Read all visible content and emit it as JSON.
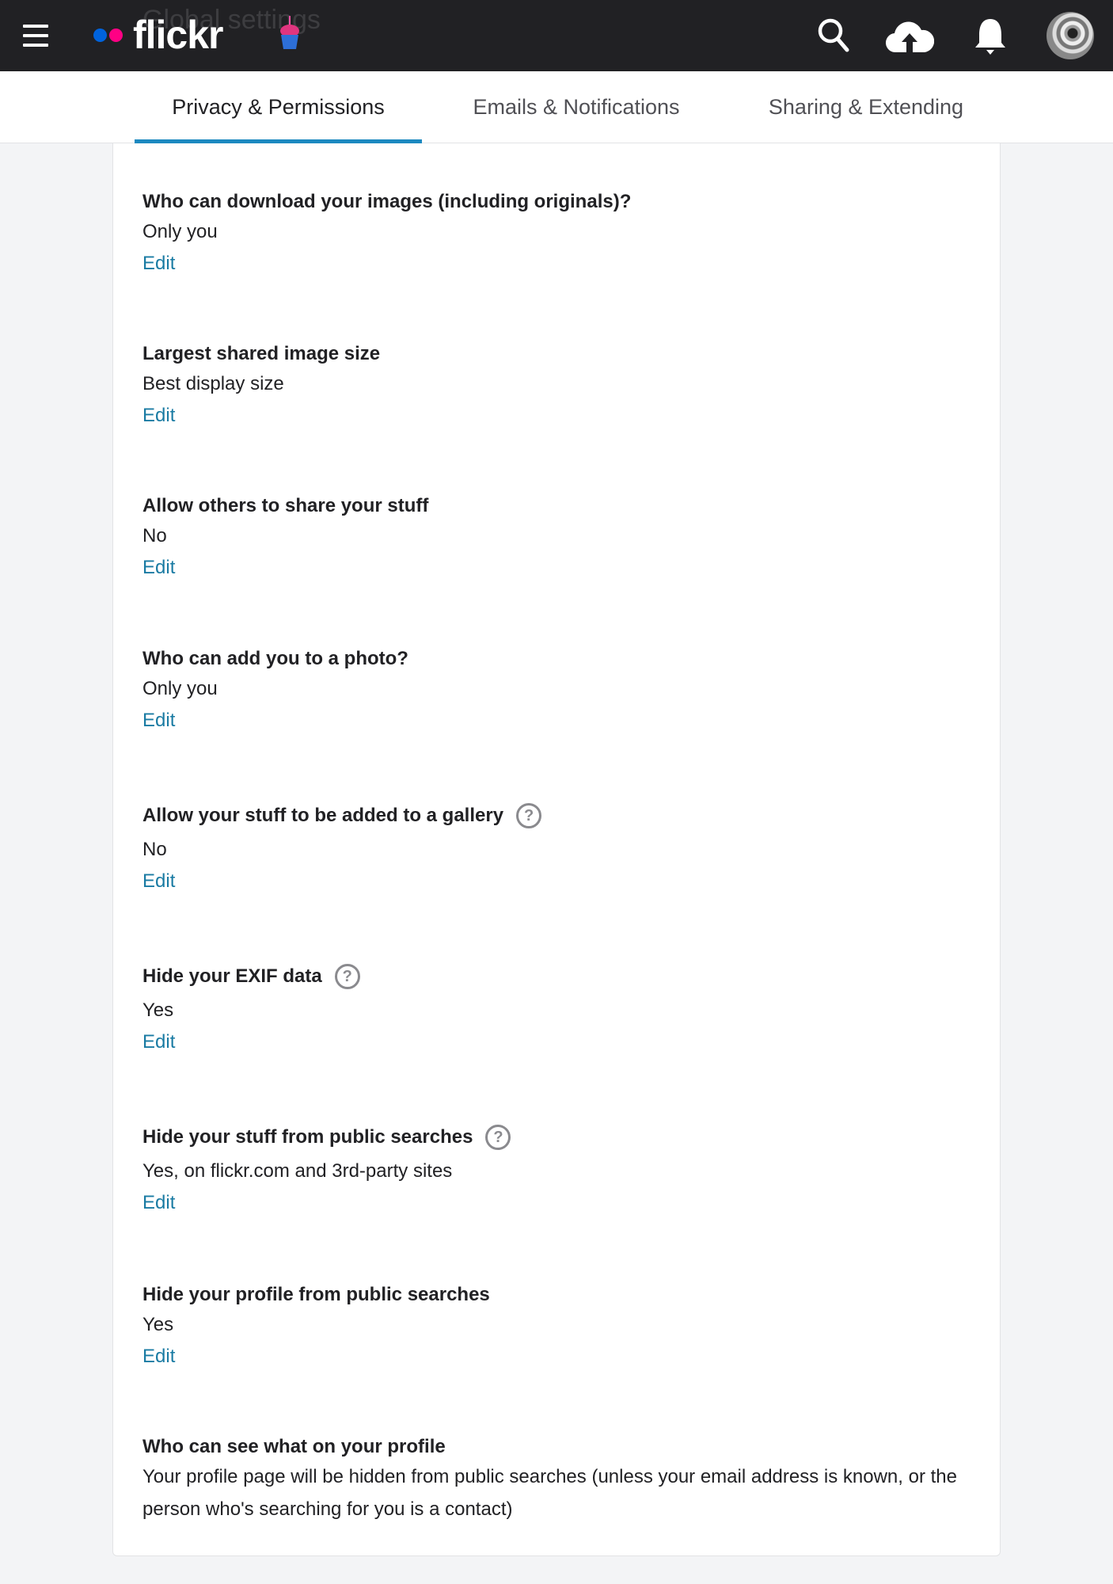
{
  "header": {
    "background_title": "Global settings",
    "logo_text": "flickr",
    "logo_dot_colors": [
      "#0063dc",
      "#ff0084"
    ],
    "icons": [
      "menu-icon",
      "cupcake-icon",
      "search-icon",
      "upload-cloud-icon",
      "bell-icon",
      "avatar"
    ]
  },
  "tabs": [
    {
      "label": "Privacy & Permissions",
      "active": true
    },
    {
      "label": "Emails & Notifications",
      "active": false
    },
    {
      "label": "Sharing & Extending",
      "active": false
    }
  ],
  "accent_color": "#1c89c0",
  "link_color": "#1a7ba3",
  "settings": [
    {
      "title": "Who can download your images (including originals)?",
      "value": "Only you",
      "edit": "Edit",
      "help": false
    },
    {
      "title": "Largest shared image size",
      "value": "Best display size",
      "edit": "Edit",
      "help": false
    },
    {
      "title": "Allow others to share your stuff",
      "value": "No",
      "edit": "Edit",
      "help": false
    },
    {
      "title": "Who can add you to a photo?",
      "value": "Only you",
      "edit": "Edit",
      "help": false
    },
    {
      "title": "Allow your stuff to be added to a gallery",
      "value": "No",
      "edit": "Edit",
      "help": true
    },
    {
      "title": "Hide your EXIF data",
      "value": "Yes",
      "edit": "Edit",
      "help": true
    },
    {
      "title": "Hide your stuff from public searches",
      "value": "Yes, on flickr.com and 3rd-party sites",
      "edit": "Edit",
      "help": true
    },
    {
      "title": "Hide your profile from public searches",
      "value": "Yes",
      "edit": "Edit",
      "help": false
    },
    {
      "title": "Who can see what on your profile",
      "value": "Your profile page will be hidden from public searches (unless your email address is known, or the person who's searching for you is a contact)",
      "help": false
    }
  ],
  "help_glyph": "?"
}
